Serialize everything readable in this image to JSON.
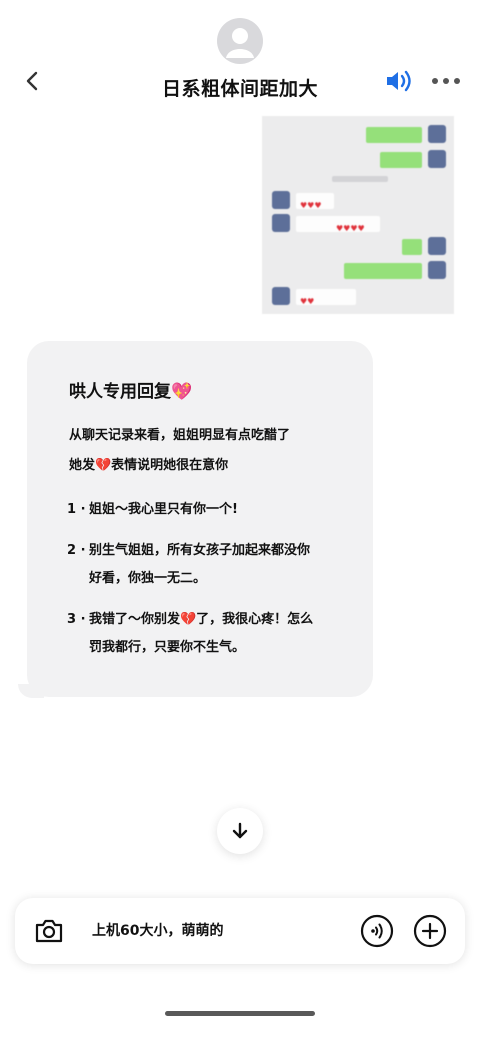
{
  "header": {
    "title": "日系粗体间距加大",
    "icons": [
      "back-chevron-icon",
      "speaker-icon",
      "more-icon"
    ],
    "accent_color": "#1f6fe5"
  },
  "card": {
    "title": "哄人专用回复💖",
    "intro_line1": "从聊天记录来看，姐姐明显有点吃醋了",
    "intro_line2": "她发💔表情说明她很在意你",
    "items": [
      {
        "num": "1 ·",
        "line1": "姐姐～我心里只有你一个!",
        "line2": ""
      },
      {
        "num": "2 ·",
        "line1": "别生气姐姐，所有女孩子加起来都没你",
        "line2": "好看，你独一无二。"
      },
      {
        "num": "3 ·",
        "line1": "我错了～你别发💔了，我很心疼！怎么",
        "line2": "罚我都行，只要你不生气。"
      }
    ]
  },
  "input": {
    "text": "上机60大小，萌萌的",
    "icons": [
      "camera-icon",
      "voice-icon",
      "plus-icon"
    ]
  },
  "colors": {
    "chat_green": "#95e07a",
    "card_bg": "#f2f2f3",
    "heart_red": "#e0323b"
  }
}
